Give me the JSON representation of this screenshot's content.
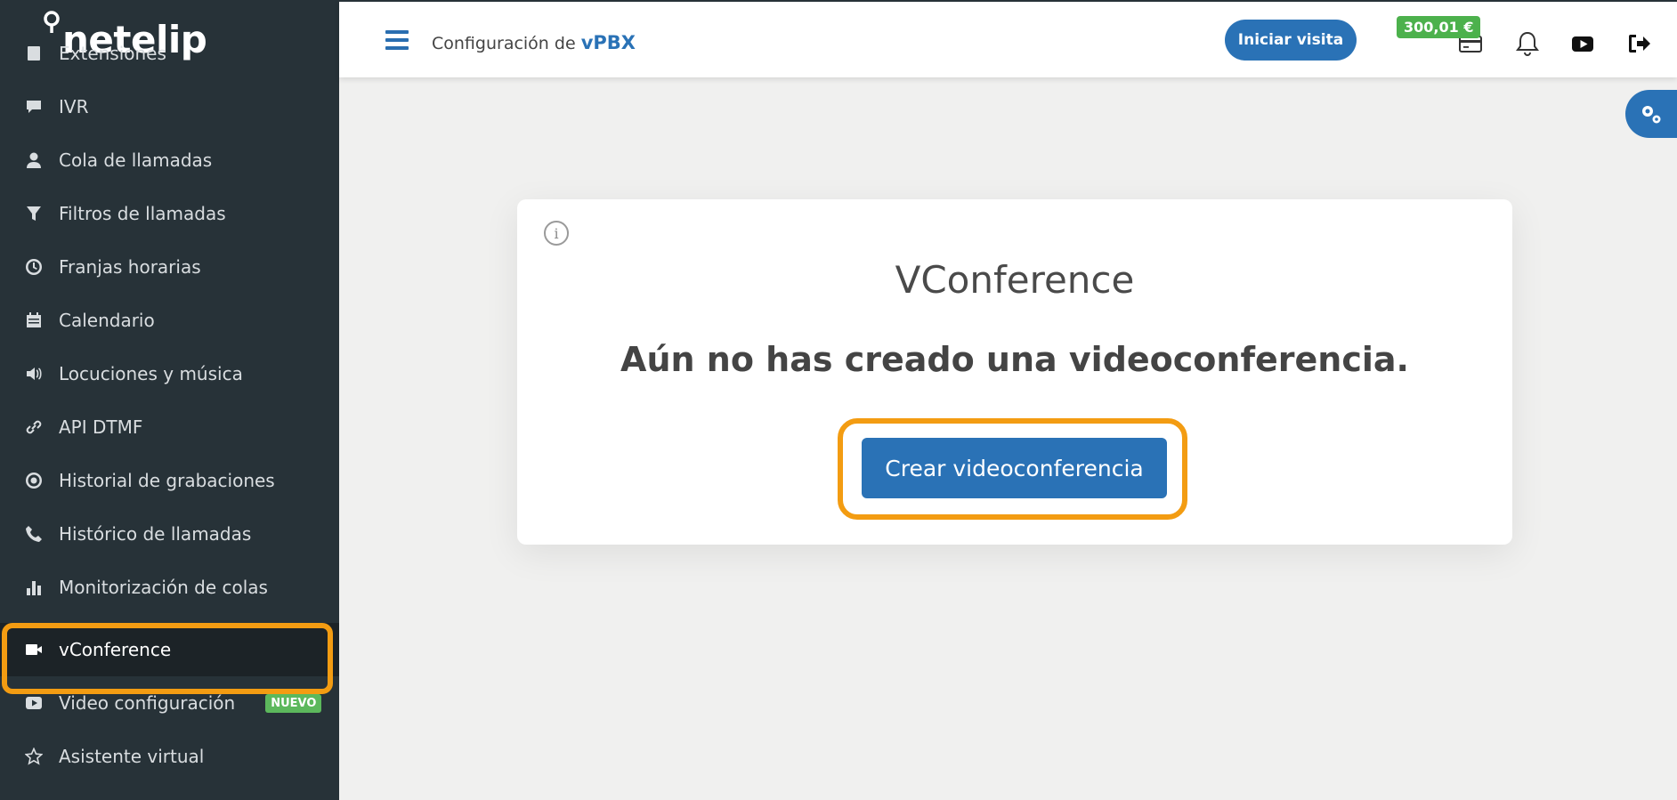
{
  "brand": {
    "name": "netelip"
  },
  "sidebar": {
    "items": [
      {
        "label": "Extensiones",
        "icon": "extensions-icon"
      },
      {
        "label": "IVR",
        "icon": "chat-icon"
      },
      {
        "label": "Cola de llamadas",
        "icon": "user-icon"
      },
      {
        "label": "Filtros de llamadas",
        "icon": "filter-icon"
      },
      {
        "label": "Franjas horarias",
        "icon": "clock-icon"
      },
      {
        "label": "Calendario",
        "icon": "calendar-icon"
      },
      {
        "label": "Locuciones y música",
        "icon": "speaker-icon"
      },
      {
        "label": "API DTMF",
        "icon": "link-icon"
      },
      {
        "label": "Historial de grabaciones",
        "icon": "record-icon"
      },
      {
        "label": "Histórico de llamadas",
        "icon": "phone-icon"
      },
      {
        "label": "Monitorización de colas",
        "icon": "bar-chart-icon"
      },
      {
        "label": "vConference",
        "icon": "video-camera-icon",
        "active": true
      },
      {
        "label": "Video configuración",
        "icon": "play-icon",
        "badge": "NUEVO"
      },
      {
        "label": "Asistente virtual",
        "icon": "star-icon"
      }
    ]
  },
  "header": {
    "title_prefix": "Configuración de",
    "title_product": "vPBX",
    "visit_button": "Iniciar visita",
    "balance": "300,01 €"
  },
  "main": {
    "card_title": "VConference",
    "message": "Aún no has creado una videoconferencia.",
    "create_button": "Crear videoconferencia"
  },
  "colors": {
    "sidebar_bg": "#273238",
    "primary": "#2a72b6",
    "highlight": "#f39c12",
    "badge_green": "#5cb85c"
  }
}
